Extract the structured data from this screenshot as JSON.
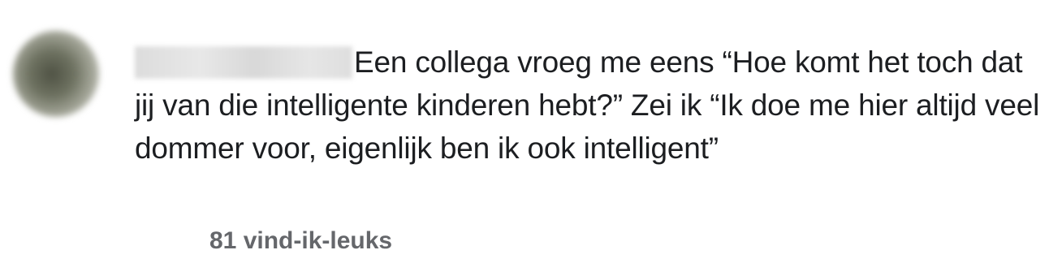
{
  "comment": {
    "text": "Een collega vroeg me eens “Hoe komt het toch dat jij van die intelligente kinderen hebt?” Zei ik “Ik doe me hier altijd veel dommer voor, eigenlijk ben ik ook intelligent”",
    "likes_label": "81 vind-ik-leuks"
  }
}
